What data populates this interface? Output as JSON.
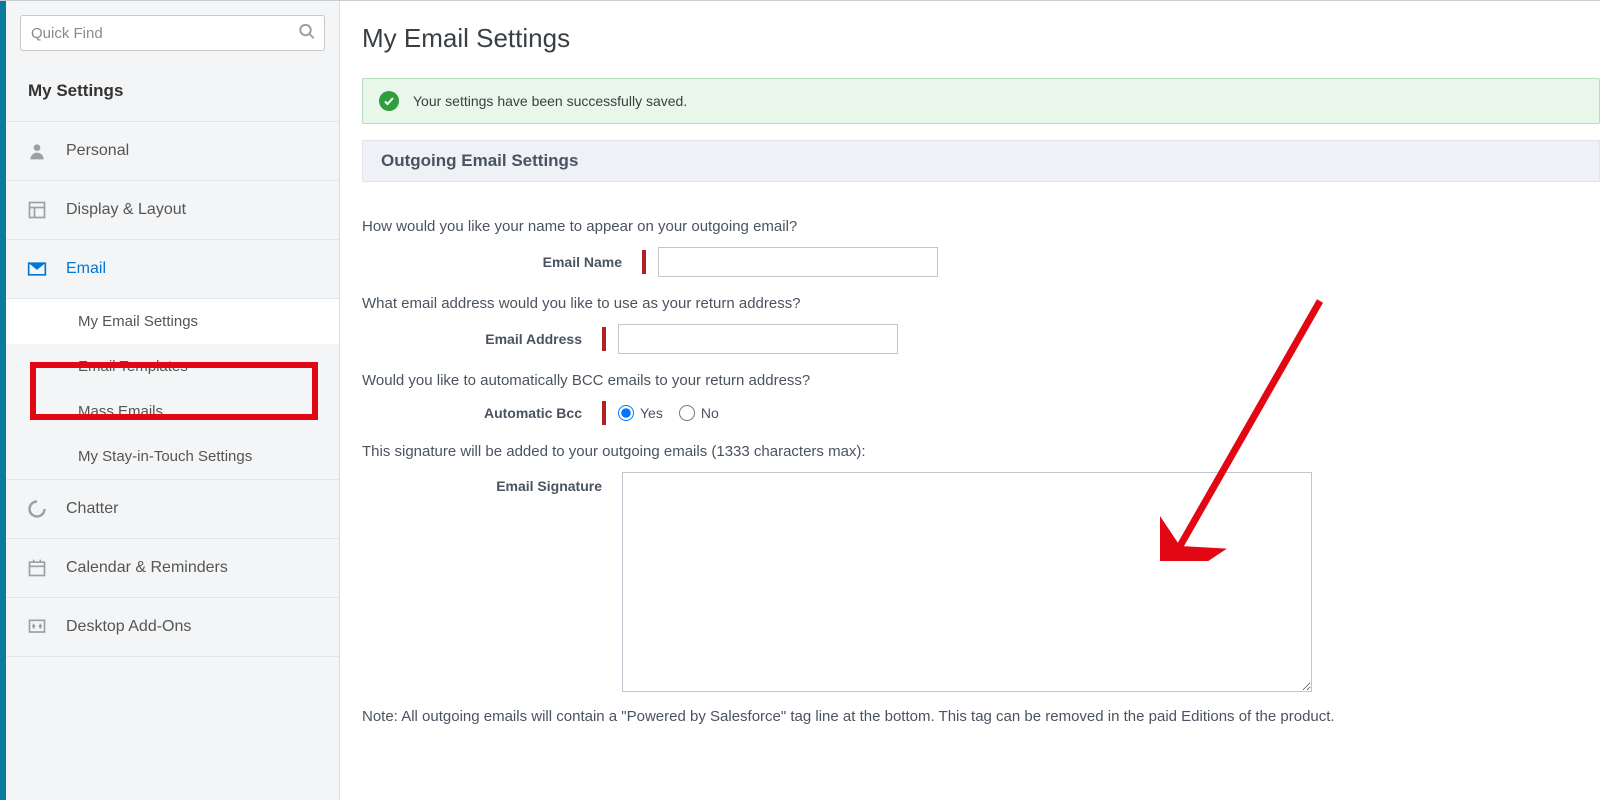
{
  "sidebar": {
    "search_placeholder": "Quick Find",
    "heading": "My Settings",
    "items": [
      {
        "label": "Personal",
        "icon": "person"
      },
      {
        "label": "Display & Layout",
        "icon": "layout"
      },
      {
        "label": "Email",
        "icon": "mail"
      },
      {
        "label": "Chatter",
        "icon": "chatter"
      },
      {
        "label": "Calendar & Reminders",
        "icon": "calendar"
      },
      {
        "label": "Desktop Add-Ons",
        "icon": "addons"
      }
    ],
    "email_sub": [
      "My Email Settings",
      "Email Templates",
      "Mass Emails",
      "My Stay-in-Touch Settings"
    ]
  },
  "main": {
    "page_title": "My Email Settings",
    "success_msg": "Your settings have been successfully saved.",
    "section_title": "Outgoing Email Settings",
    "prompts": {
      "name": "How would you like your name to appear on your outgoing email?",
      "address": "What email address would you like to use as your return address?",
      "bcc": "Would you like to automatically BCC emails to your return address?",
      "signature": "This signature will be added to your outgoing emails (1333 characters max):"
    },
    "labels": {
      "email_name": "Email Name",
      "email_address": "Email Address",
      "auto_bcc": "Automatic Bcc",
      "email_signature": "Email Signature"
    },
    "bcc_options": {
      "yes": "Yes",
      "no": "No"
    },
    "note": "Note: All outgoing emails will contain a \"Powered by Salesforce\" tag line at the bottom. This tag can be removed in the paid Editions of the product."
  }
}
